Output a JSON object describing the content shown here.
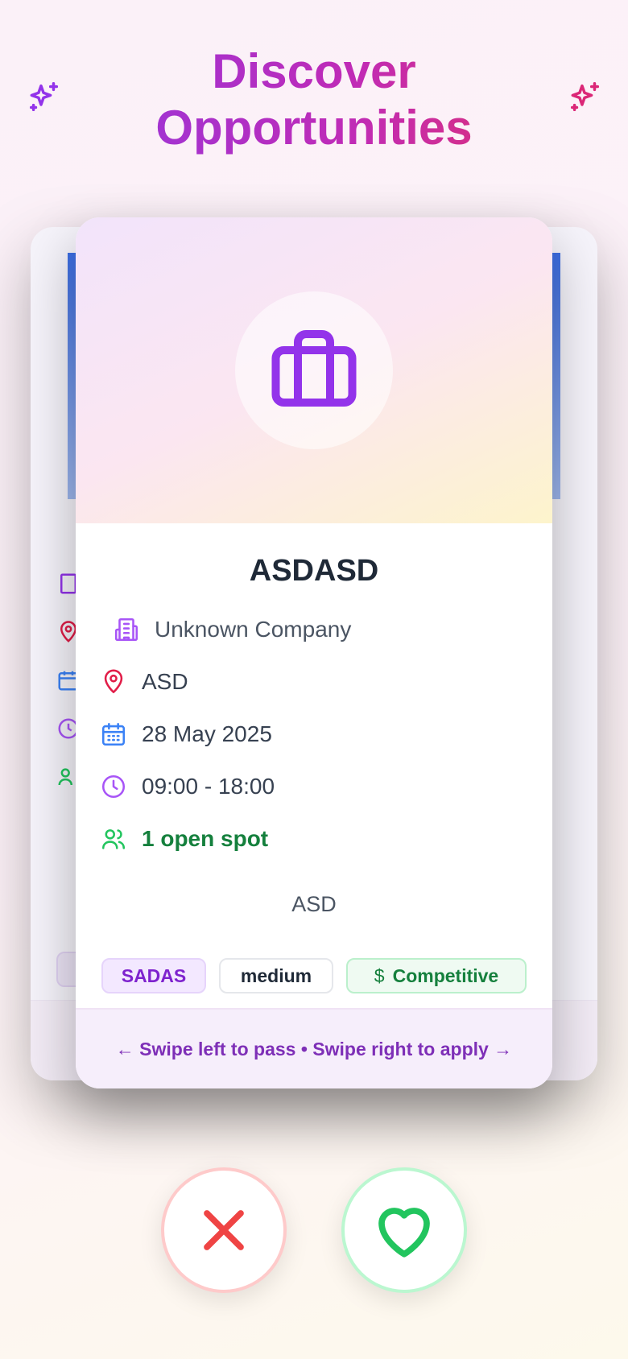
{
  "header": {
    "title": "Discover Opportunities"
  },
  "card": {
    "title": "ASDASD",
    "company": "Unknown Company",
    "location": "ASD",
    "date": "28 May 2025",
    "time": "09:00 - 18:00",
    "spots": "1 open spot",
    "description": "ASD",
    "tags": [
      "SADAS",
      "medium",
      "Competitive"
    ],
    "swipe_hint": "← Swipe left to pass • Swipe right to apply →"
  },
  "colors": {
    "title_gradient_start": "#9d34d6",
    "title_gradient_end": "#d9307f",
    "accent_purple": "#9333ea",
    "location_red": "#e11d48",
    "calendar_blue": "#3b82f6",
    "spots_green": "#15803d",
    "pass_red": "#ef4444",
    "apply_green": "#22c55e"
  },
  "icons": {
    "header_left": "sparkles-icon",
    "header_right": "sparkles-icon",
    "hero": "briefcase-icon",
    "company": "building-icon",
    "location": "map-pin-icon",
    "date": "calendar-icon",
    "time": "clock-icon",
    "spots": "users-icon",
    "salary": "dollar-icon",
    "pass": "x-icon",
    "apply": "heart-icon"
  }
}
